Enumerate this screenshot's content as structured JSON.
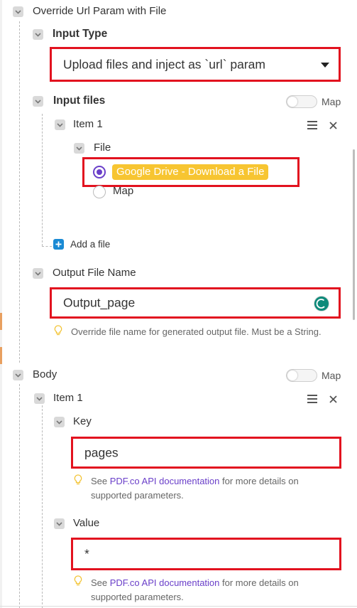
{
  "section": {
    "title": "Override Url Param with File"
  },
  "input_type": {
    "label": "Input Type",
    "value": "Upload files and inject as `url` param"
  },
  "input_files": {
    "label": "Input files",
    "map_label": "Map",
    "item": {
      "label": "Item 1",
      "file": {
        "label": "File",
        "option_selected": "Google Drive - Download a File",
        "option_map": "Map"
      }
    },
    "add_label": "Add a file"
  },
  "output_file_name": {
    "label": "Output File Name",
    "value": "Output_page",
    "hint": "Override file name for generated output file. Must be a String."
  },
  "body": {
    "label": "Body",
    "map_label": "Map",
    "item": {
      "label": "Item 1",
      "key": {
        "label": "Key",
        "value": "pages",
        "hint_prefix": "See ",
        "hint_link": "PDF.co API documentation",
        "hint_suffix": " for more details on",
        "hint_line2": "supported parameters."
      },
      "value": {
        "label": "Value",
        "value": "*",
        "hint_prefix": "See ",
        "hint_link": "PDF.co API documentation",
        "hint_suffix": " for more details on",
        "hint_line2": "supported parameters."
      }
    }
  },
  "colors": {
    "highlight_border": "#e2121f",
    "chip_bg": "#f7c531",
    "radio_selected": "#6a3fc9",
    "link": "#6a3fc9",
    "add_icon": "#1a8ad4",
    "status_icon": "#0e8a7a"
  },
  "icons": [
    "checkbox-icon",
    "hamburger-icon",
    "close-icon",
    "dropdown-caret-icon",
    "lightbulb-icon",
    "plus-icon",
    "status-icon"
  ]
}
